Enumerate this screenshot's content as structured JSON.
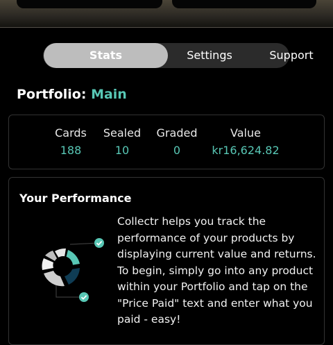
{
  "tabs": [
    {
      "label": "Stats",
      "active": true
    },
    {
      "label": "Settings",
      "active": false
    },
    {
      "label": "Support",
      "active": false
    }
  ],
  "portfolio": {
    "prefix": "Portfolio:",
    "name": "Main"
  },
  "stats": [
    {
      "label": "Cards",
      "value": "188"
    },
    {
      "label": "Sealed",
      "value": "10"
    },
    {
      "label": "Graded",
      "value": "0"
    },
    {
      "label": "Value",
      "value": "kr16,624.82"
    }
  ],
  "performance": {
    "title": "Your Performance",
    "description": "Collectr helps you track the performance of your products by displaying current value and returns. To begin, simply go into any product within your Portfolio and tap on the \"Price Paid\" text and enter what you paid - easy!"
  },
  "colors": {
    "accent": "#58c7b5",
    "background": "#000000",
    "tab_active": "#bdbdbd"
  }
}
